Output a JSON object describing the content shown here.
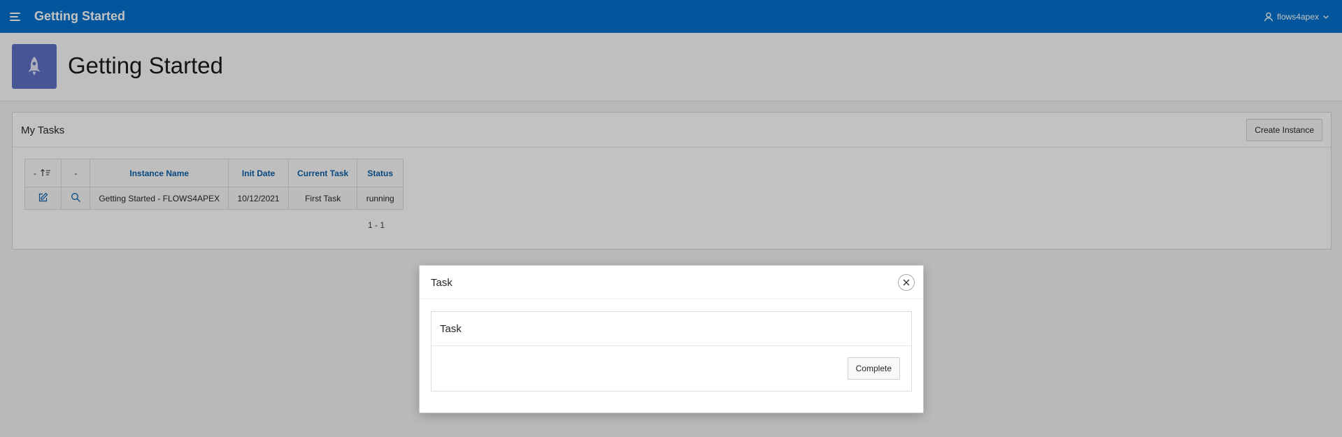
{
  "header": {
    "app_title": "Getting Started",
    "user_name": "flows4apex"
  },
  "hero": {
    "title": "Getting Started",
    "icon": "rocket-icon"
  },
  "region": {
    "title": "My Tasks",
    "create_button": "Create Instance"
  },
  "report": {
    "columns": [
      "-",
      "-",
      "Instance Name",
      "Init Date",
      "Current Task",
      "Status"
    ],
    "rows": [
      {
        "instance_name": "Getting Started - FLOWS4APEX",
        "init_date": "10/12/2021",
        "current_task": "First Task",
        "status": "running"
      }
    ],
    "pagination": "1 - 1"
  },
  "dialog": {
    "title": "Task",
    "region_title": "Task",
    "complete_button": "Complete"
  },
  "colors": {
    "header_bg": "#0572ce",
    "hero_icon_bg": "#5e70c6",
    "link_blue": "#0b5ea8"
  }
}
